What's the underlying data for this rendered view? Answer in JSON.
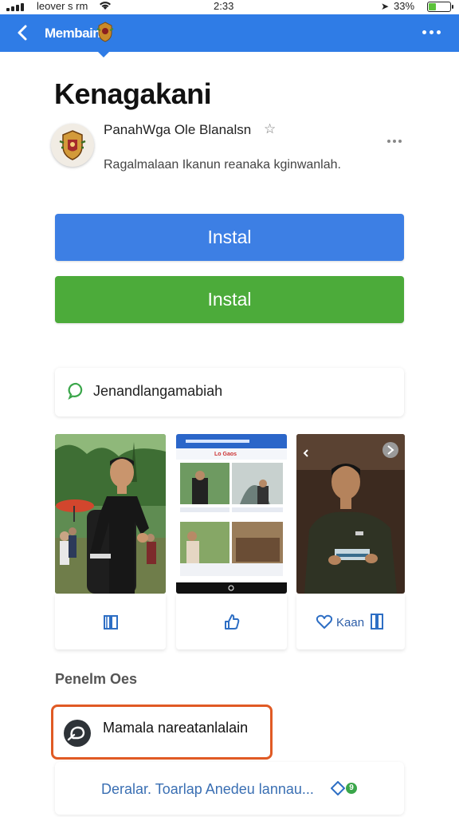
{
  "status": {
    "carrier": "leover s rm",
    "time": "2:33",
    "battery_pct": "33%",
    "battery_level": 0.33
  },
  "header": {
    "brand": "Membain",
    "back_icon": "chevron-left-icon",
    "menu_icon": "more-horizontal-icon",
    "color": "#2f7ce6"
  },
  "app": {
    "title": "Kenagakani",
    "developer": "PanahWga Ole Blanalsn",
    "description": "Ragalmalaan Ikanun reanaka kginwanlah.",
    "install_primary": "Instal",
    "install_secondary": "Instal",
    "primary_color": "#3d7fe4",
    "secondary_color": "#4cab3a"
  },
  "info": {
    "label": "Jenandlangamabiah",
    "icon": "chat-bubble-icon"
  },
  "screenshots": {
    "mid_screen_title": "Lo Gaos",
    "card3_text": "Kaan"
  },
  "reviews": {
    "title": "Penelm Oes",
    "highlighted": "Mamala nareatanlalain",
    "footer": "Deralar. Toarlap Anedeu lannau..."
  }
}
